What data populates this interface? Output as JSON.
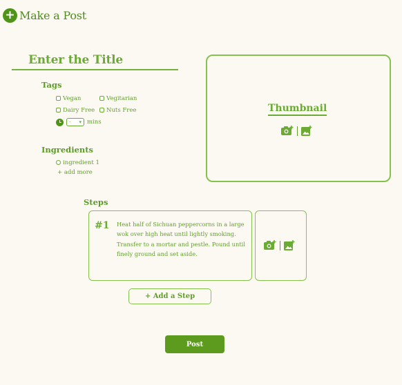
{
  "header": {
    "title": "Make a Post",
    "icon": "plus-circle-icon"
  },
  "form": {
    "title_placeholder": "Enter the Title",
    "tags": {
      "label": "Tags",
      "options": [
        "Vegan",
        "Vegitarian",
        "Dairy Free",
        "Nuts Free"
      ],
      "time_value": "-",
      "time_unit": "mins"
    },
    "ingredients": {
      "label": "Ingredients",
      "items": [
        "ingredient 1"
      ],
      "add_more": "+ add more"
    },
    "thumbnail": {
      "label": "Thumbnail",
      "icons": [
        "camera-add-icon",
        "image-add-icon"
      ]
    },
    "steps": {
      "label": "Steps",
      "items": [
        {
          "number": "#1",
          "text": "Heat half of Sichuan peppercorns in a large wok over high heat until lightly smoking. Transfer to a mortar and pestle. Pound until finely ground and set aside."
        }
      ],
      "add_step": "+ Add a Step"
    },
    "submit": "Post"
  },
  "colors": {
    "background": "#fcf9f3",
    "accent": "#5c9b1d",
    "accent_light": "#84c24e"
  }
}
